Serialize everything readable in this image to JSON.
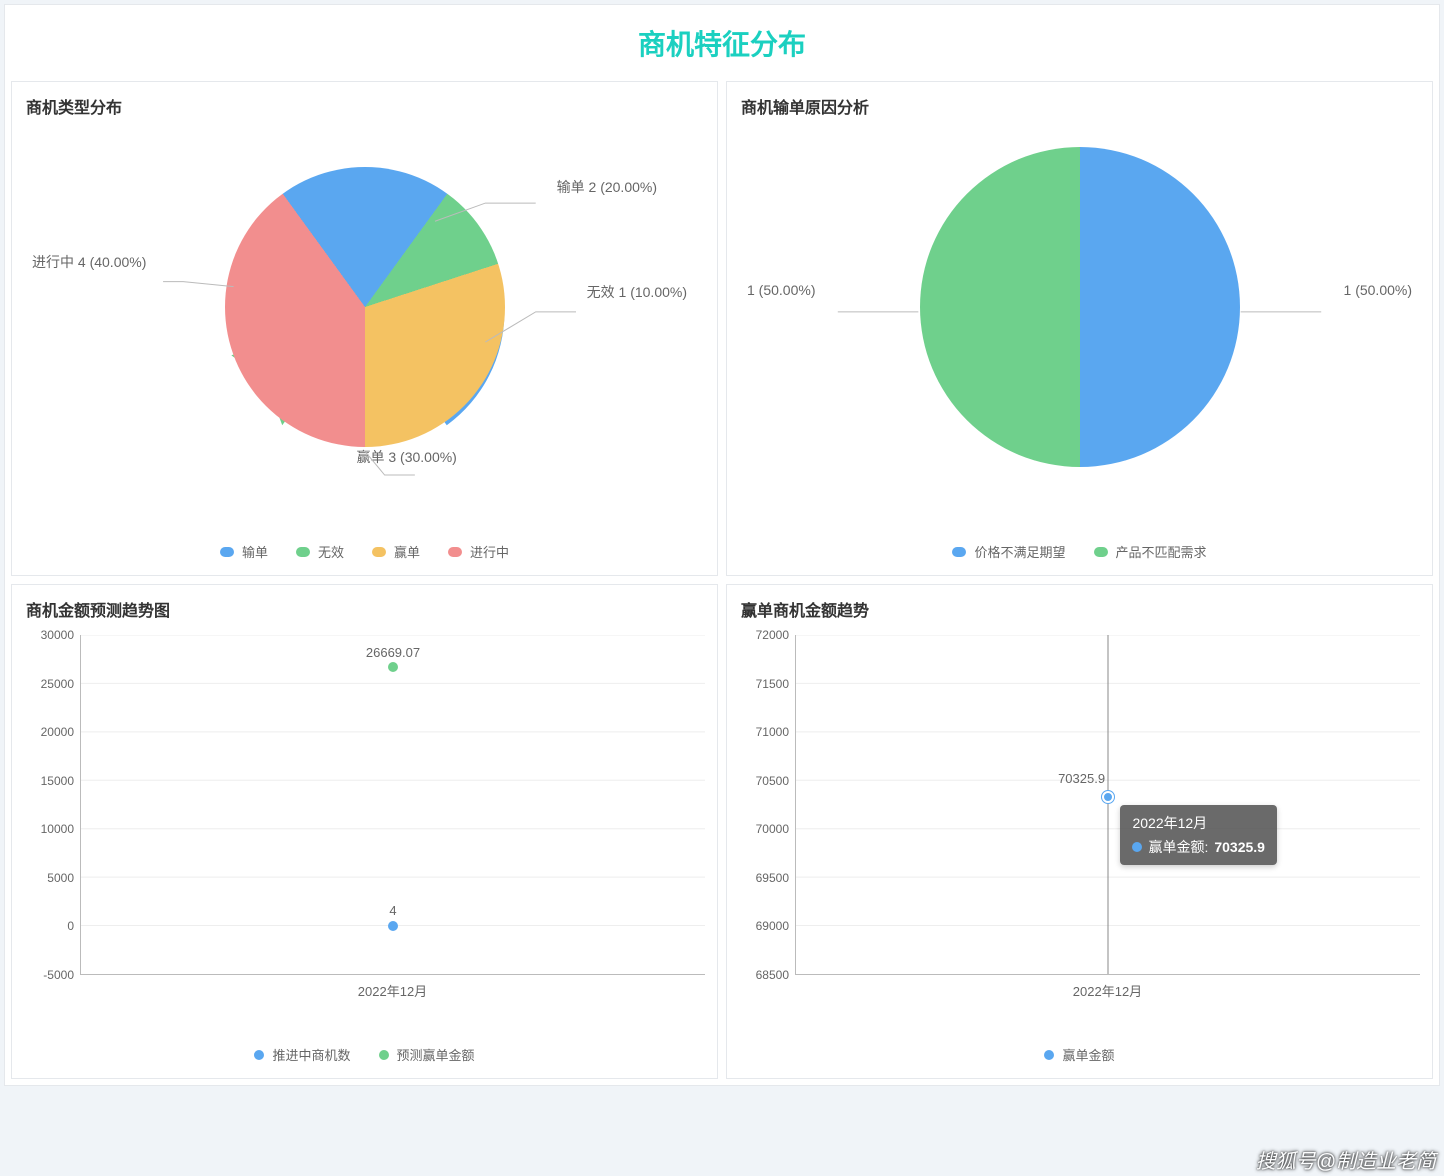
{
  "page_title": "商机特征分布",
  "watermark": "搜狐号@制造业老简",
  "panels": {
    "type_dist": {
      "title": "商机类型分布"
    },
    "loss_reason": {
      "title": "商机输单原因分析"
    },
    "amount_trend": {
      "title": "商机金额预测趋势图"
    },
    "win_trend": {
      "title": "赢单商机金额趋势"
    }
  },
  "chart_data": [
    {
      "id": "type_dist",
      "type": "pie",
      "title": "商机类型分布",
      "series": [
        {
          "name": "输单",
          "value": 2,
          "percent": 20.0,
          "color": "#5aa7f0",
          "label": "输单 2 (20.00%)"
        },
        {
          "name": "无效",
          "value": 1,
          "percent": 10.0,
          "color": "#6fd08c",
          "label": "无效 1 (10.00%)"
        },
        {
          "name": "赢单",
          "value": 3,
          "percent": 30.0,
          "color": "#f4c262",
          "label": "赢单 3 (30.00%)"
        },
        {
          "name": "进行中",
          "value": 4,
          "percent": 40.0,
          "color": "#f28e8e",
          "label": "进行中 4 (40.00%)"
        }
      ],
      "legend": [
        "输单",
        "无效",
        "赢单",
        "进行中"
      ]
    },
    {
      "id": "loss_reason",
      "type": "pie",
      "title": "商机输单原因分析",
      "series": [
        {
          "name": "价格不满足期望",
          "value": 1,
          "percent": 50.0,
          "color": "#5aa7f0",
          "label": "1 (50.00%)"
        },
        {
          "name": "产品不匹配需求",
          "value": 1,
          "percent": 50.0,
          "color": "#6fd08c",
          "label": "1 (50.00%)"
        }
      ],
      "legend": [
        "价格不满足期望",
        "产品不匹配需求"
      ]
    },
    {
      "id": "amount_trend",
      "type": "scatter",
      "title": "商机金额预测趋势图",
      "x": [
        "2022年12月"
      ],
      "ylim": [
        -5000,
        30000
      ],
      "yticks": [
        -5000,
        0,
        5000,
        10000,
        15000,
        20000,
        25000,
        30000
      ],
      "series": [
        {
          "name": "推进中商机数",
          "color": "#5aa7f0",
          "values": [
            4
          ],
          "label": "4"
        },
        {
          "name": "预测赢单金额",
          "color": "#6fd08c",
          "values": [
            26669.07
          ],
          "label": "26669.07"
        }
      ],
      "legend": [
        "推进中商机数",
        "预测赢单金额"
      ]
    },
    {
      "id": "win_trend",
      "type": "scatter",
      "title": "赢单商机金额趋势",
      "x": [
        "2022年12月"
      ],
      "ylim": [
        68500,
        72000
      ],
      "yticks": [
        68500,
        69000,
        69500,
        70000,
        70500,
        71000,
        71500,
        72000
      ],
      "series": [
        {
          "name": "赢单金额",
          "color": "#5aa7f0",
          "values": [
            70325.9
          ],
          "label": "70325.9"
        }
      ],
      "tooltip": {
        "title": "2022年12月",
        "row_label": "赢单金额:",
        "row_value": "70325.9"
      },
      "legend": [
        "赢单金额"
      ]
    }
  ]
}
